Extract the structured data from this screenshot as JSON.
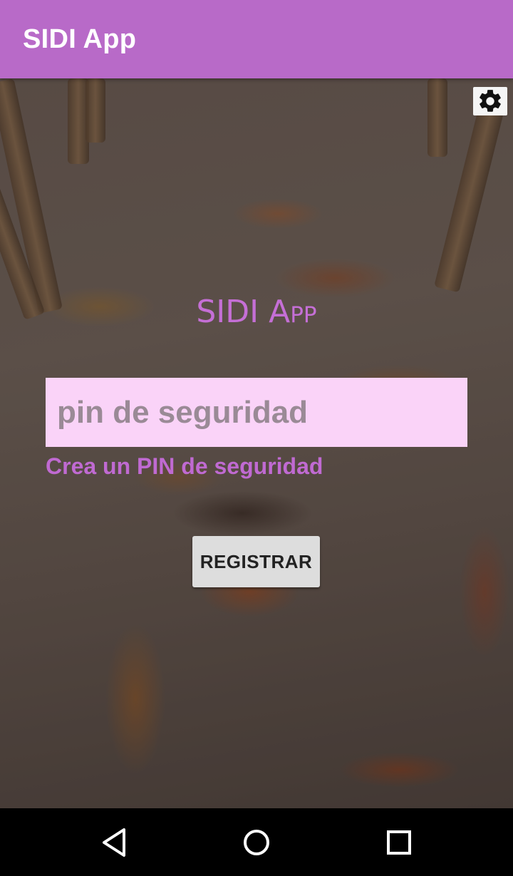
{
  "appbar": {
    "title": "SIDI App",
    "color": "#b86ac8"
  },
  "toolbar": {
    "settings_icon": "gear-icon"
  },
  "main": {
    "title": "SIDI App",
    "pin_placeholder": "pin de seguridad",
    "pin_value": "",
    "pin_hint": "Crea un PIN de seguridad",
    "register_label": "REGISTRAR",
    "accent_color": "#c56fd6",
    "input_background": "#fad3f8"
  },
  "navbar": {
    "back_icon": "back-triangle-icon",
    "home_icon": "home-circle-icon",
    "recent_icon": "recent-apps-square-icon"
  }
}
